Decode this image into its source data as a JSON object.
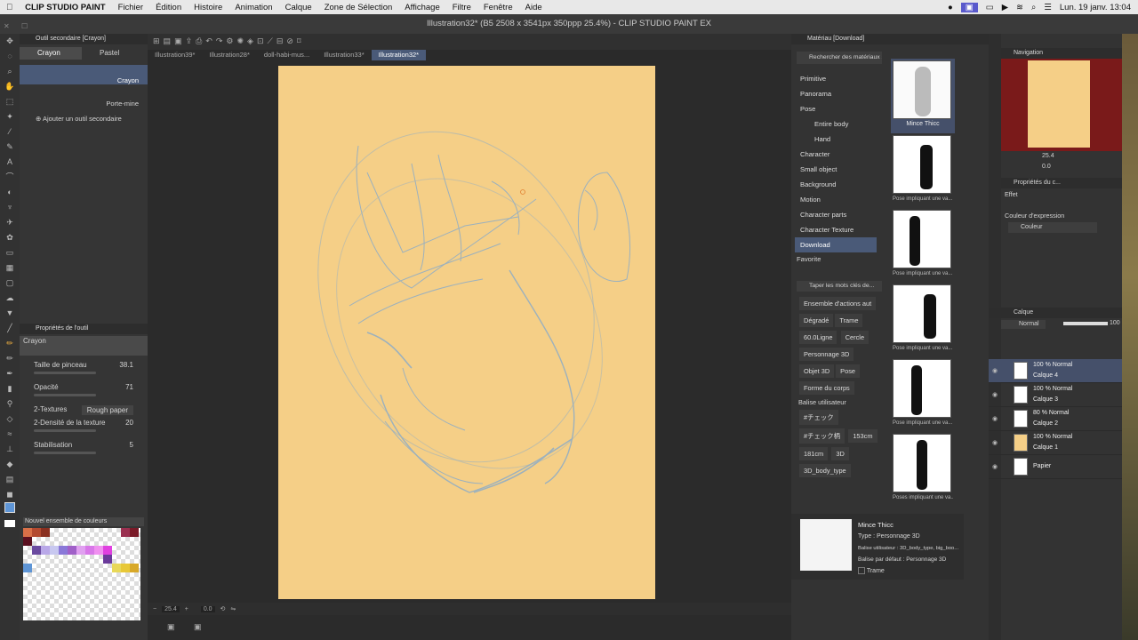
{
  "menubar": {
    "apple": "",
    "app": "CLIP STUDIO PAINT",
    "items": [
      "Fichier",
      "Édition",
      "Histoire",
      "Animation",
      "Calque",
      "Zone de Sélection",
      "Affichage",
      "Filtre",
      "Fenêtre",
      "Aide"
    ],
    "datetime": "Lun. 19 janv. 13:04"
  },
  "window": {
    "title": "Illustration32* (B5 2508 x 3541px 350ppp 25.4%) - CLIP STUDIO PAINT EX"
  },
  "doc_tabs": [
    "Illustration39*",
    "Illustration28*",
    "doll-habi-mus...",
    "Illustration33*",
    "Illustration32*"
  ],
  "subtool": {
    "header": "Outil secondaire [Crayon]",
    "tab1": "Crayon",
    "tab2": "Pastel",
    "items": [
      "Crayon",
      "Porte-mine"
    ],
    "add": "Ajouter un outil secondaire"
  },
  "toolprops": {
    "header": "Propriétés de l'outil",
    "name": "Crayon",
    "brush_size_label": "Taille de pinceau",
    "brush_size": "38.1",
    "opacity_label": "Opacité",
    "opacity": "71",
    "textures_label": "2-Textures",
    "texture_value": "Rough paper",
    "density_label": "2-Densité de la texture",
    "density": "20",
    "stab_label": "Stabilisation",
    "stab": "5"
  },
  "colorset": {
    "header": "Nouvel ensemble de couleurs"
  },
  "status": {
    "zoom": "25.4",
    "angle": "0.0"
  },
  "material": {
    "header": "Matériau [Download]",
    "search": "Rechercher des matériaux sur",
    "tree": [
      "Primitive",
      "Panorama",
      "Pose",
      "Entire body",
      "Hand",
      "Character",
      "Small object",
      "Background",
      "Motion",
      "Character parts",
      "Character Texture",
      "Download"
    ],
    "favorite": "Favorite",
    "tag_search": "Taper les mots clés de...",
    "tags": [
      "Ensemble d'actions aut",
      "Dégradé",
      "Trame",
      "60.0Ligne",
      "Cercle",
      "Personnage 3D",
      "Objet 3D",
      "Pose",
      "Forme du corps"
    ],
    "user_tags_label": "Balise utilisateur",
    "user_tags": [
      "#チェック",
      "#チェック柄",
      "153cm",
      "181cm",
      "3D",
      "3D_body_type"
    ],
    "thumbs": [
      "Mince Thicc",
      "Pose impliquant une va...",
      "Pose impliquant une va...",
      "Pose impliquant une va...",
      "Pose impliquant une va...",
      "Poses impliquant une va..."
    ],
    "detail_name": "Mince Thicc",
    "detail_type": "Type : Personnage 3D",
    "detail_tags": "Balise utilisateur : 3D_body_type, big_boo...",
    "detail_default": "Balise par défaut : Personnage 3D",
    "detail_trame": "Trame"
  },
  "navigator": {
    "header": "Navigation",
    "zoom": "25.4",
    "angle": "0.0"
  },
  "subprops": {
    "header": "Propriétés du c...",
    "effect": "Effet",
    "expr_label": "Couleur d'expression",
    "expr_value": "Couleur"
  },
  "layers": {
    "header": "Calque",
    "blend": "Normal",
    "opacity": "100",
    "list": [
      {
        "info": "100 % Normal",
        "name": "Calque 4"
      },
      {
        "info": "100 % Normal",
        "name": "Calque 3"
      },
      {
        "info": "80 % Normal",
        "name": "Calque 2"
      },
      {
        "info": "100 % Normal",
        "name": "Calque 1"
      },
      {
        "info": "",
        "name": "Papier"
      }
    ]
  },
  "colors": {
    "accent": "#4a5a78",
    "canvas": "#f5cf87",
    "sketch": "#7fa7cf"
  }
}
